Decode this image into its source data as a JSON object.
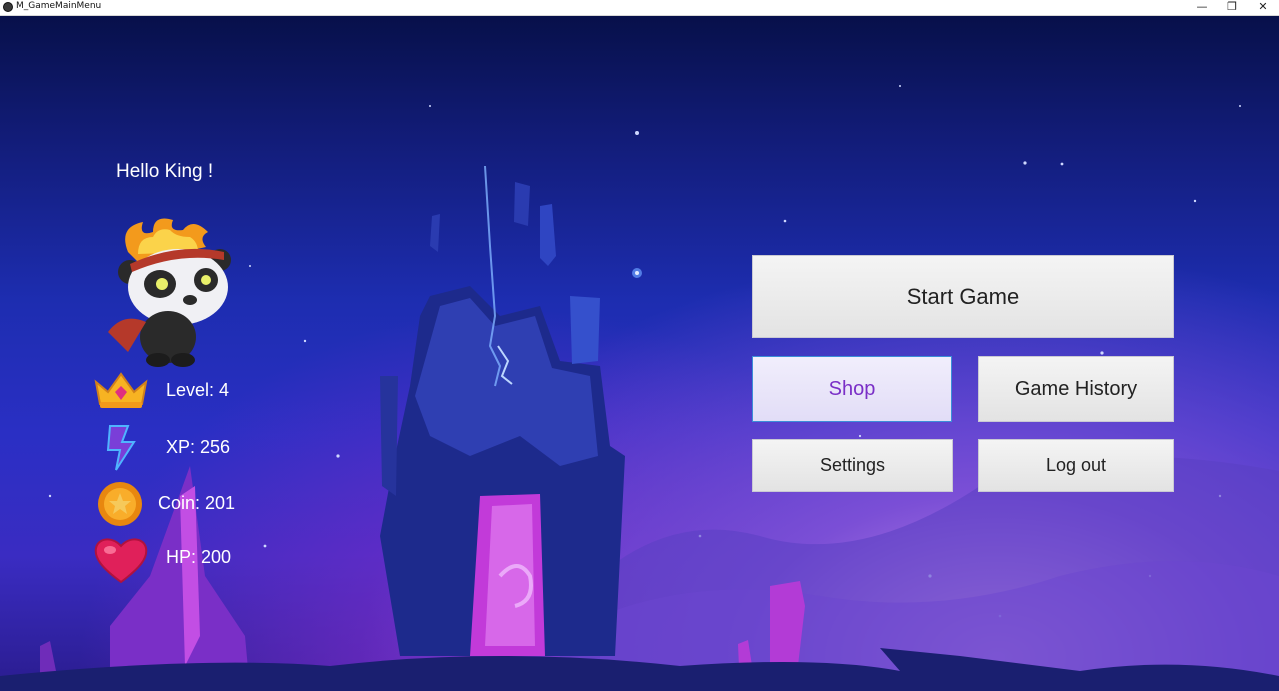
{
  "window": {
    "title": "M_GameMainMenu",
    "controls": {
      "minimize": "—",
      "maximize": "❐",
      "close": "✕"
    }
  },
  "player": {
    "greeting": "Hello King !",
    "stats": [
      {
        "name": "level",
        "icon": "crown-icon",
        "label": "Level: 4"
      },
      {
        "name": "xp",
        "icon": "lightning-icon",
        "label": "XP: 256"
      },
      {
        "name": "coin",
        "icon": "coin-icon",
        "label": "Coin: 201"
      },
      {
        "name": "hp",
        "icon": "heart-icon",
        "label": "HP: 200"
      }
    ]
  },
  "menu": {
    "start_game": "Start Game",
    "shop": "Shop",
    "game_history": "Game History",
    "settings": "Settings",
    "log_out": "Log out"
  },
  "colors": {
    "sky_top": "#07104a",
    "sky_mid": "#1d2db0",
    "accent_purple": "#7a2fc7",
    "focus_border": "#3b8ed8"
  }
}
